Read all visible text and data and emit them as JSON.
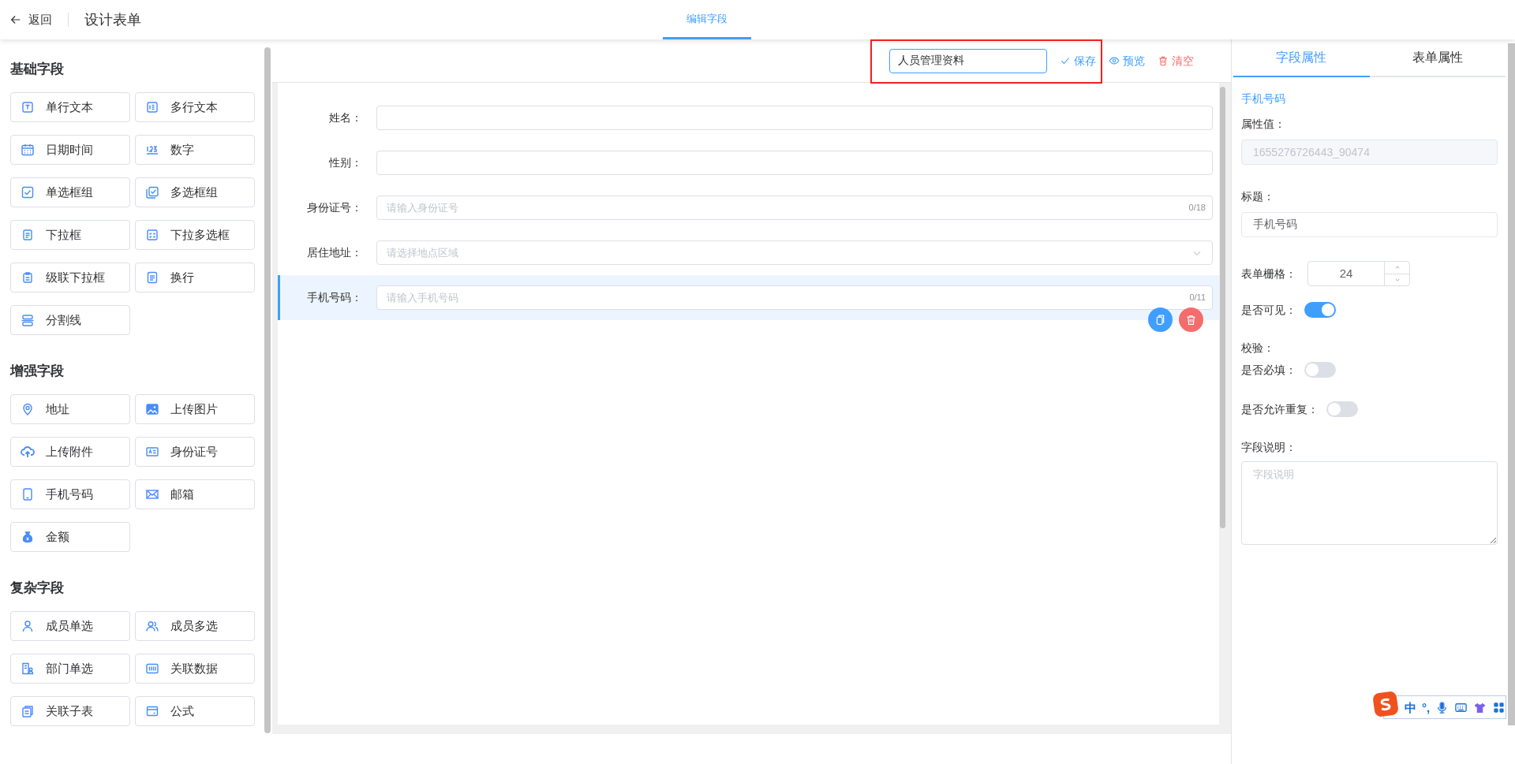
{
  "header": {
    "back": "返回",
    "title": "设计表单",
    "tabs": [
      {
        "label": "编辑字段",
        "selected": true
      }
    ]
  },
  "palette": [
    {
      "title": "基础字段",
      "items": [
        {
          "label": "单行文本"
        },
        {
          "label": "多行文本"
        },
        {
          "label": "日期时间"
        },
        {
          "label": "数字"
        },
        {
          "label": "单选框组"
        },
        {
          "label": "多选框组"
        },
        {
          "label": "下拉框"
        },
        {
          "label": "下拉多选框"
        },
        {
          "label": "级联下拉框"
        },
        {
          "label": "换行"
        },
        {
          "label": "分割线"
        }
      ]
    },
    {
      "title": "增强字段",
      "items": [
        {
          "label": "地址"
        },
        {
          "label": "上传图片"
        },
        {
          "label": "上传附件"
        },
        {
          "label": "身份证号"
        },
        {
          "label": "手机号码"
        },
        {
          "label": "邮箱"
        },
        {
          "label": "金额"
        }
      ]
    },
    {
      "title": "复杂字段",
      "items": [
        {
          "label": "成员单选"
        },
        {
          "label": "成员多选"
        },
        {
          "label": "部门单选"
        },
        {
          "label": "关联数据"
        },
        {
          "label": "关联子表"
        },
        {
          "label": "公式"
        }
      ]
    }
  ],
  "toolbar": {
    "form_name": "人员管理资料",
    "actions": [
      {
        "label": "保存",
        "kind": "save"
      },
      {
        "label": "预览",
        "kind": "preview"
      },
      {
        "label": "清空",
        "kind": "clear"
      }
    ]
  },
  "form_fields": [
    {
      "label": "姓名：",
      "kind": "text",
      "selected": false
    },
    {
      "label": "性别：",
      "kind": "text",
      "selected": false
    },
    {
      "label": "身份证号：",
      "kind": "text",
      "placeholder": "请输入身份证号",
      "counter": "0/18",
      "selected": false
    },
    {
      "label": "居住地址：",
      "kind": "select",
      "placeholder": "请选择地点区域",
      "selected": false
    },
    {
      "label": "手机号码：",
      "kind": "text",
      "placeholder": "请输入手机号码",
      "counter": "0/11",
      "selected": true
    }
  ],
  "properties": {
    "tabs": [
      {
        "label": "字段属性",
        "selected": true
      },
      {
        "label": "表单属性",
        "selected": false
      }
    ],
    "field_name": "手机号码",
    "items": [
      {
        "kind": "input",
        "label": "属性值：",
        "value": "1655276726443_90474",
        "disabled": true
      },
      {
        "kind": "input",
        "label": "标题：",
        "value": "手机号码",
        "disabled": false
      },
      {
        "kind": "number",
        "label": "表单栅格：",
        "value": "24"
      },
      {
        "kind": "switch",
        "label": "是否可见：",
        "on": true
      },
      {
        "kind": "heading",
        "label": "校验："
      },
      {
        "kind": "switch",
        "label": "是否必填：",
        "on": false
      },
      {
        "kind": "switch",
        "label": "是否允许重复：",
        "on": false
      },
      {
        "kind": "textarea",
        "label": "字段说明：",
        "placeholder": "字段说明"
      }
    ]
  },
  "ime_toolbar": {
    "labels": [
      "中",
      "°,"
    ]
  }
}
